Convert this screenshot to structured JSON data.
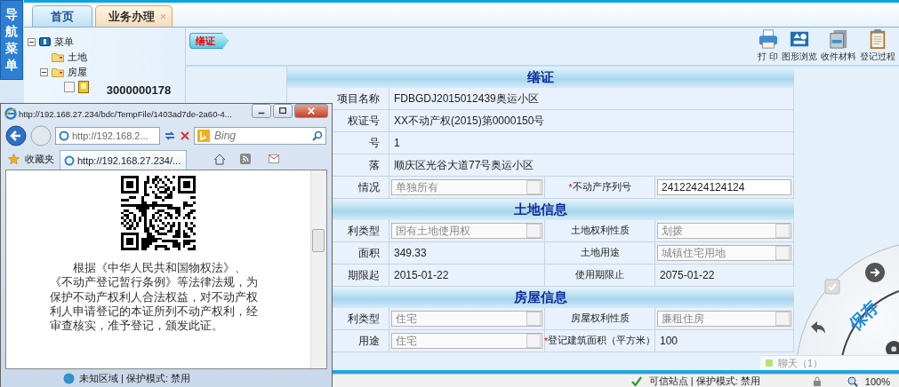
{
  "nav_strip": {
    "label": "导航菜单"
  },
  "tabs": [
    {
      "label": "首页",
      "selected": false
    },
    {
      "label": "业务办理",
      "selected": true,
      "close_glyph": "×"
    }
  ],
  "tree": [
    {
      "label": "菜单",
      "kind": "book",
      "expanded": true,
      "children": [
        {
          "label": "土地",
          "kind": "folder"
        },
        {
          "label": "房屋",
          "kind": "folder",
          "expanded": true,
          "children": [
            {
              "label": "3000000178",
              "kind": "document",
              "checked": false
            }
          ]
        }
      ]
    }
  ],
  "step_tag": "缮证",
  "toolbar": [
    {
      "label": "打 印",
      "kind": "printer"
    },
    {
      "label": "图形浏览",
      "kind": "shapes"
    },
    {
      "label": "收件材料",
      "kind": "cabinet"
    },
    {
      "label": "登记过程",
      "kind": "clipboard"
    }
  ],
  "form": {
    "sections": [
      {
        "title": "缮证",
        "rows": [
          [
            {
              "label": "项目名称",
              "kind": "text",
              "value": "FDBGDJ2015012439奥运小区"
            }
          ],
          [
            {
              "label": "权证号",
              "kind": "text",
              "value": "XX不动产权(2015)第0000150号"
            }
          ],
          [
            {
              "label": "号",
              "kind": "text",
              "value": "1"
            }
          ],
          [
            {
              "label": "落",
              "kind": "text",
              "value": "顺庆区光谷大道77号奥运小区"
            }
          ],
          [
            {
              "label": "情况",
              "kind": "select",
              "disabled": true,
              "value": "单独所有"
            },
            {
              "label": "不动产序列号",
              "marker": "*",
              "kind": "input",
              "value": "24122424124124"
            }
          ]
        ]
      },
      {
        "title": "土地信息",
        "rows": [
          [
            {
              "label": "利类型",
              "kind": "select",
              "disabled": true,
              "value": "国有土地使用权"
            },
            {
              "label": "土地权利性质",
              "kind": "select",
              "disabled": true,
              "value": "划拨"
            }
          ],
          [
            {
              "label": "面积",
              "kind": "text",
              "value": "349.33"
            },
            {
              "label": "土地用途",
              "kind": "select",
              "disabled": true,
              "value": "城镇住宅用地"
            }
          ],
          [
            {
              "label": "期限起",
              "kind": "text",
              "value": "2015-01-22"
            },
            {
              "label": "使用期限止",
              "kind": "text",
              "value": "2075-01-22"
            }
          ]
        ]
      },
      {
        "title": "房屋信息",
        "rows": [
          [
            {
              "label": "利类型",
              "kind": "select",
              "disabled": true,
              "value": "住宅"
            },
            {
              "label": "房屋权利性质",
              "kind": "select",
              "disabled": true,
              "value": "廉租住房"
            }
          ],
          [
            {
              "label": "用途",
              "kind": "select",
              "disabled": true,
              "value": "住宅"
            },
            {
              "label": "登记建筑面积（平方米）",
              "marker": "*",
              "kind": "text",
              "value": "100"
            }
          ]
        ]
      }
    ]
  },
  "save_wheel": {
    "label": "保存"
  },
  "chat": {
    "label": "聊天（1）"
  },
  "status_bar": {
    "zone": "可信站点 | 保护模式: 禁用",
    "zoom": "100%"
  },
  "popup": {
    "title": "http://192.168.27.234/bdc/TempFile/1403ad7de-2a60-4...",
    "address": "http://192.168.2...",
    "search_placeholder": "Bing",
    "favorites": "收藏夹",
    "tab": "http://192.168.27.234/...",
    "body": "根据《中华人民共和国物权法》、《不动产登记暂行条例》等法律法规，为保护不动产权利人合法权益，对不动产权利人申请登记的本证所列不动产权利，经审查核实，准予登记，颁发此证。",
    "status": "未知区域 | 保护模式: 禁用"
  }
}
